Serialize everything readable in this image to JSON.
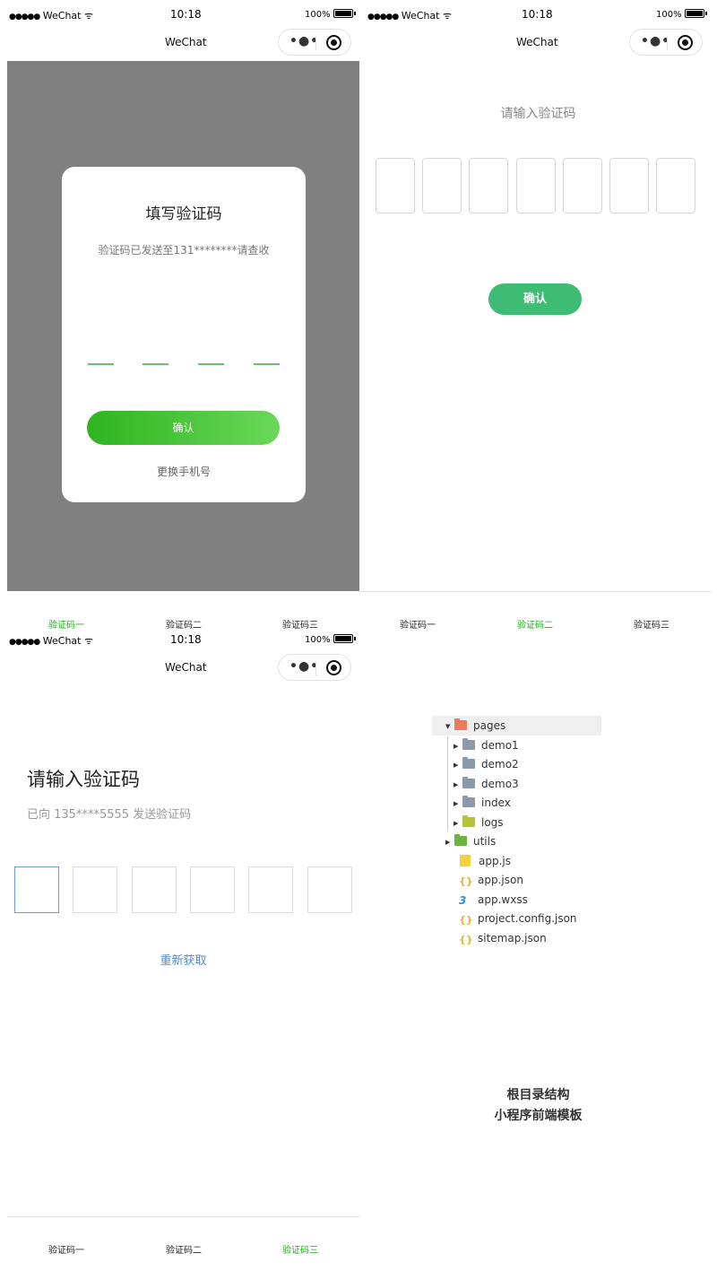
{
  "status": {
    "carrier": "WeChat",
    "signal_dots": "●●●●●",
    "time": "10:18",
    "battery": "100%"
  },
  "nav": {
    "title": "WeChat",
    "more": "•●•"
  },
  "tabs": [
    "验证码一",
    "验证码二",
    "验证码三"
  ],
  "panel1": {
    "title": "填写验证码",
    "subtitle": "验证码已发送至131********请查收",
    "confirm": "确认",
    "change_phone": "更换手机号"
  },
  "panel2": {
    "title": "请输入验证码",
    "confirm": "确认"
  },
  "panel3": {
    "title": "请输入验证码",
    "subtitle": "已向 135****5555 发送验证码",
    "resend": "重新获取"
  },
  "tree": {
    "pages": "pages",
    "demo1": "demo1",
    "demo2": "demo2",
    "demo3": "demo3",
    "index": "index",
    "logs": "logs",
    "utils": "utils",
    "app_js": "app.js",
    "app_json": "app.json",
    "app_wxss": "app.wxss",
    "project_config": "project.config.json",
    "sitemap": "sitemap.json"
  },
  "caption": {
    "line1": "根目录结构",
    "line2": "小程序前端模板"
  },
  "colors": {
    "accent_green": "#1aad19",
    "button_green": "#3fbc74",
    "link_blue": "#4f8ad6",
    "overlay_gray": "#808080"
  }
}
